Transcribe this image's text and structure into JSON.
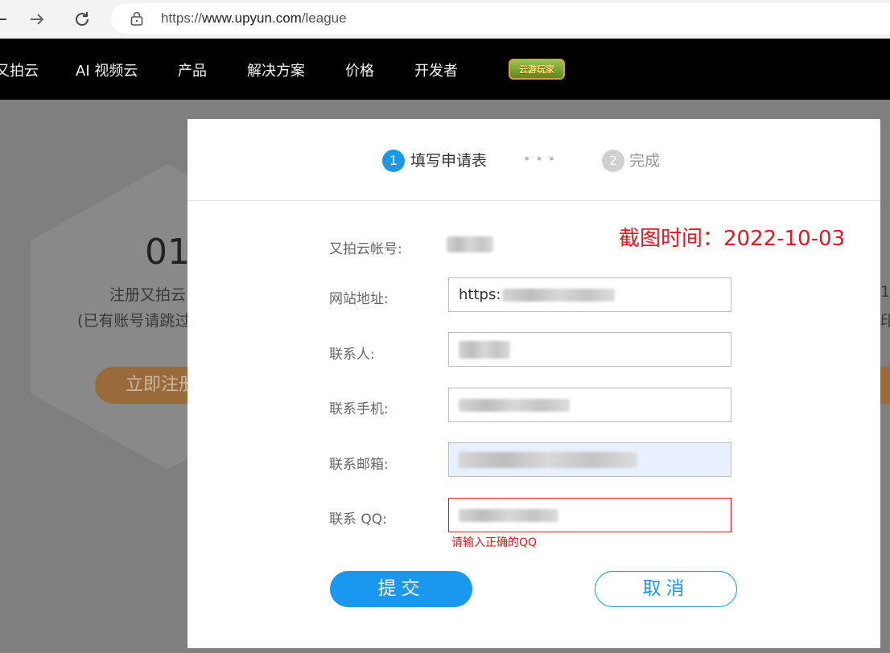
{
  "browser": {
    "back_icon": "back-arrow-icon",
    "forward_icon": "forward-arrow-icon",
    "reload_icon": "reload-icon",
    "url_prefix": "https://",
    "url_domain": "www.upyun.com",
    "url_path": "/league"
  },
  "site_nav": {
    "items": [
      {
        "label": "又拍云"
      },
      {
        "label": "AI 视频云"
      },
      {
        "label": "产品"
      },
      {
        "label": "解决方案"
      },
      {
        "label": "价格"
      },
      {
        "label": "开发者"
      }
    ],
    "badge_text": "云游玩家"
  },
  "background_page": {
    "step_number": "01",
    "line1": "注册又拍云",
    "line2": "(已有账号请跳过",
    "button_label": "立即注册",
    "right_line1": "1",
    "right_line2": "印"
  },
  "modal": {
    "steps": [
      {
        "number": "1",
        "label": "填写申请表",
        "color": "#1a98ef"
      },
      {
        "number": "2",
        "label": "完成",
        "color": "#d0d0d0"
      }
    ],
    "dots": "•••",
    "watermark": "截图时间：2022-10-03",
    "fields": {
      "account_label": "又拍云帐号:",
      "website_label": "网站地址:",
      "website_value": "https:",
      "contact_label": "联系人:",
      "phone_label": "联系手机:",
      "email_label": "联系邮箱:",
      "qq_label": "联系 QQ:"
    },
    "error_message": "请输入正确的QQ",
    "submit_label": "提交",
    "cancel_label": "取消"
  },
  "colors": {
    "accent": "#1a98ef",
    "error": "#e0191d",
    "overlay": "#7f7f7f"
  }
}
